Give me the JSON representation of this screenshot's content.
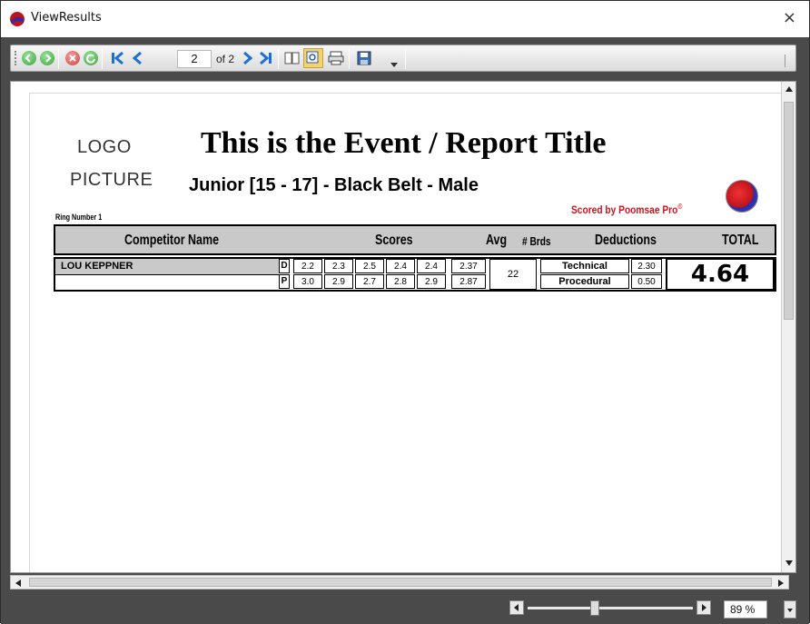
{
  "window": {
    "title": "ViewResults",
    "close_glyph": "×"
  },
  "toolbar": {
    "page_value": "2",
    "page_of": "of 2",
    "zoom_value": "89 %",
    "zoom_level": 0.4,
    "icons": [
      "back-icon",
      "forward-icon",
      "stop-icon",
      "refresh-icon",
      "first-page-icon",
      "previous-page-icon",
      "next-page-icon",
      "last-page-icon",
      "document-map-icon",
      "print-layout-icon",
      "page-setup-icon",
      "save-icon",
      "dropdown-icon"
    ]
  },
  "report": {
    "logo_line1": "LOGO",
    "logo_line2": "PICTURE",
    "title": "This is the Event / Report Title",
    "subtitle": "Junior [15 - 17] - Black Belt - Male",
    "ring": "Ring Number 1",
    "scored_by": "Scored by Poomsae Pro",
    "scored_by_mark": "©",
    "headers": {
      "competitor": "Competitor Name",
      "scores": "Scores",
      "avg": "Avg",
      "boards": "# Brds",
      "deductions": "Deductions",
      "total": "TOTAL"
    },
    "competitor": {
      "name": "LOU KEPPNER",
      "d_label": "D",
      "p_label": "P",
      "d_scores": [
        "2.2",
        "2.3",
        "2.5",
        "2.4",
        "2.4"
      ],
      "p_scores": [
        "3.0",
        "2.9",
        "2.7",
        "2.8",
        "2.9"
      ],
      "d_avg": "2.37",
      "p_avg": "2.87",
      "boards": "22",
      "technical_label": "Technical",
      "technical_value": "2.30",
      "procedural_label": "Procedural",
      "procedural_value": "0.50",
      "total": "4.64"
    }
  },
  "colors": {
    "chrome": "#4a4a4a",
    "accent_blue": "#1e6fd9",
    "accent_green": "#3aa63a",
    "accent_red": "#d0121b",
    "header_gray": "#c9c9c9"
  }
}
